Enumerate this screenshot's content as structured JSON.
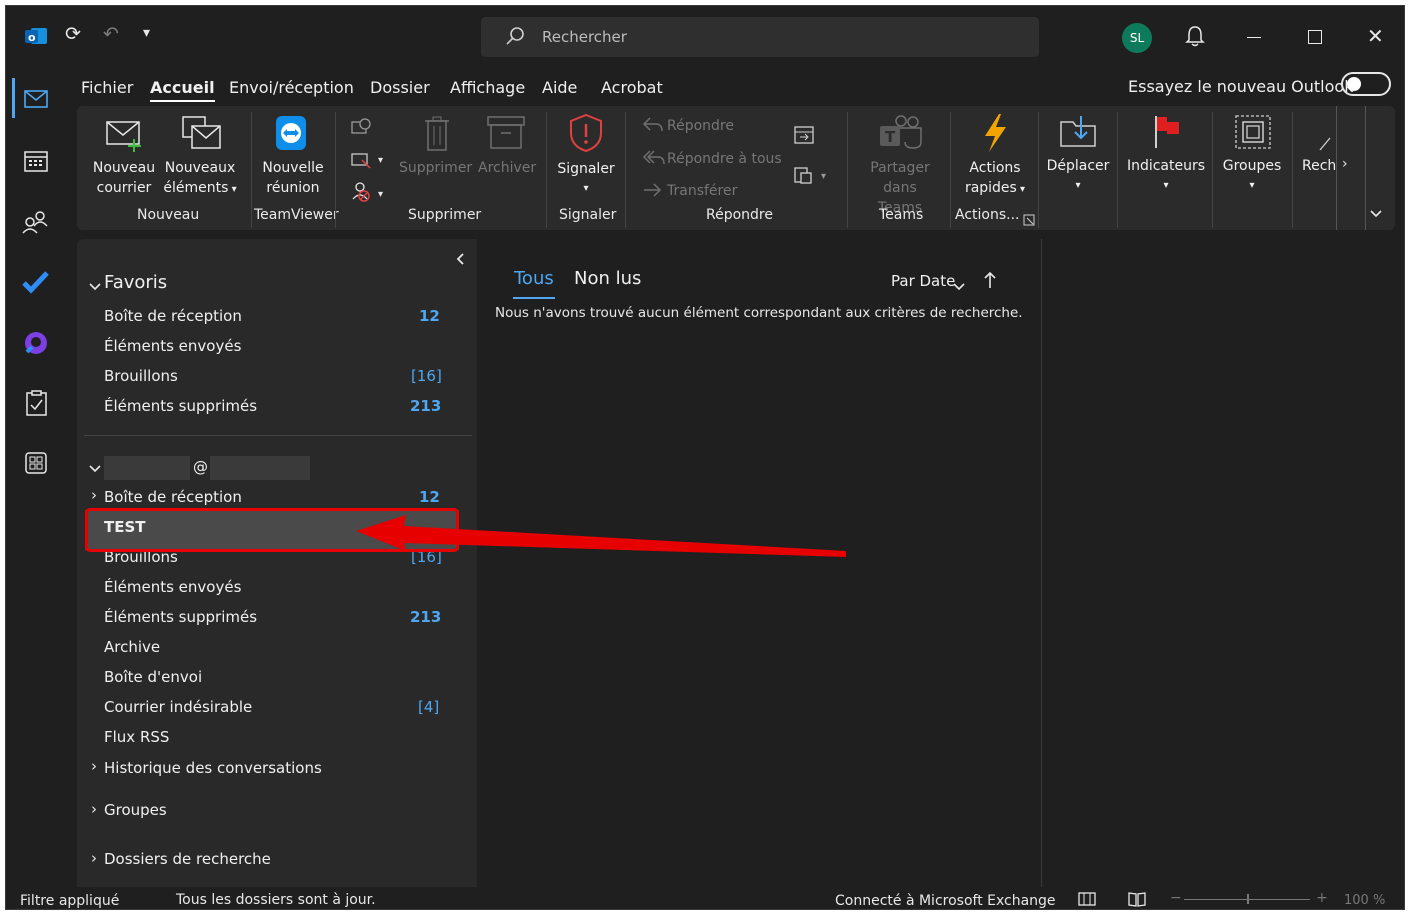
{
  "titlebar": {
    "search_placeholder": "Rechercher",
    "avatar_initials": "SL",
    "colors": {
      "accent": "#4ea7f0",
      "avatar": "#0e7a5c",
      "annotation": "#e60000"
    }
  },
  "menu": {
    "items": [
      "Fichier",
      "Accueil",
      "Envoi/réception",
      "Dossier",
      "Affichage",
      "Aide",
      "Acrobat"
    ],
    "active": "Accueil",
    "try_new": "Essayez le nouveau Outlook"
  },
  "ribbon": {
    "new_mail": [
      "Nouveau",
      "courrier"
    ],
    "new_items": [
      "Nouveaux",
      "éléments"
    ],
    "new_meeting": [
      "Nouvelle",
      "réunion"
    ],
    "delete": "Supprimer",
    "archive": "Archiver",
    "report": "Signaler",
    "reply": "Répondre",
    "reply_all": "Répondre à tous",
    "forward": "Transférer",
    "share_teams": [
      "Partager",
      "dans Teams"
    ],
    "quick_actions": [
      "Actions",
      "rapides"
    ],
    "move": "Déplacer",
    "flags": "Indicateurs",
    "groups": "Groupes",
    "search_cut": "Rech",
    "group_labels": {
      "new": "Nouveau",
      "teamviewer": "TeamViewer",
      "delete": "Supprimer",
      "report": "Signaler",
      "respond": "Répondre",
      "teams": "Teams",
      "actions": "Actions..."
    }
  },
  "favorites": {
    "title": "Favoris",
    "items": [
      {
        "label": "Boîte de réception",
        "count": "12"
      },
      {
        "label": "Éléments envoyés",
        "count": ""
      },
      {
        "label": "Brouillons",
        "count": "[16]"
      },
      {
        "label": "Éléments supprimés",
        "count": "213"
      }
    ]
  },
  "account": {
    "name": "@",
    "items": [
      {
        "label": "Boîte de réception",
        "count": "12"
      },
      {
        "label": "TEST",
        "count": ""
      },
      {
        "label": "Brouillons",
        "count": "[16]"
      },
      {
        "label": "Éléments envoyés",
        "count": ""
      },
      {
        "label": "Éléments supprimés",
        "count": "213"
      },
      {
        "label": "Archive",
        "count": ""
      },
      {
        "label": "Boîte d'envoi",
        "count": ""
      },
      {
        "label": "Courrier indésirable",
        "count": "[4]"
      },
      {
        "label": "Flux RSS",
        "count": ""
      },
      {
        "label": "Historique des conversations",
        "count": ""
      }
    ],
    "groups": "Groupes",
    "search_folders": "Dossiers de recherche"
  },
  "list": {
    "tab_all": "Tous",
    "tab_unread": "Non lus",
    "sort": "Par Date",
    "empty_message": "Nous n'avons trouvé aucun élément correspondant aux critères de recherche."
  },
  "status": {
    "filter": "Filtre appliqué",
    "sync": "Tous les dossiers sont à jour.",
    "connection": "Connecté à Microsoft Exchange",
    "zoom": "100 %"
  }
}
